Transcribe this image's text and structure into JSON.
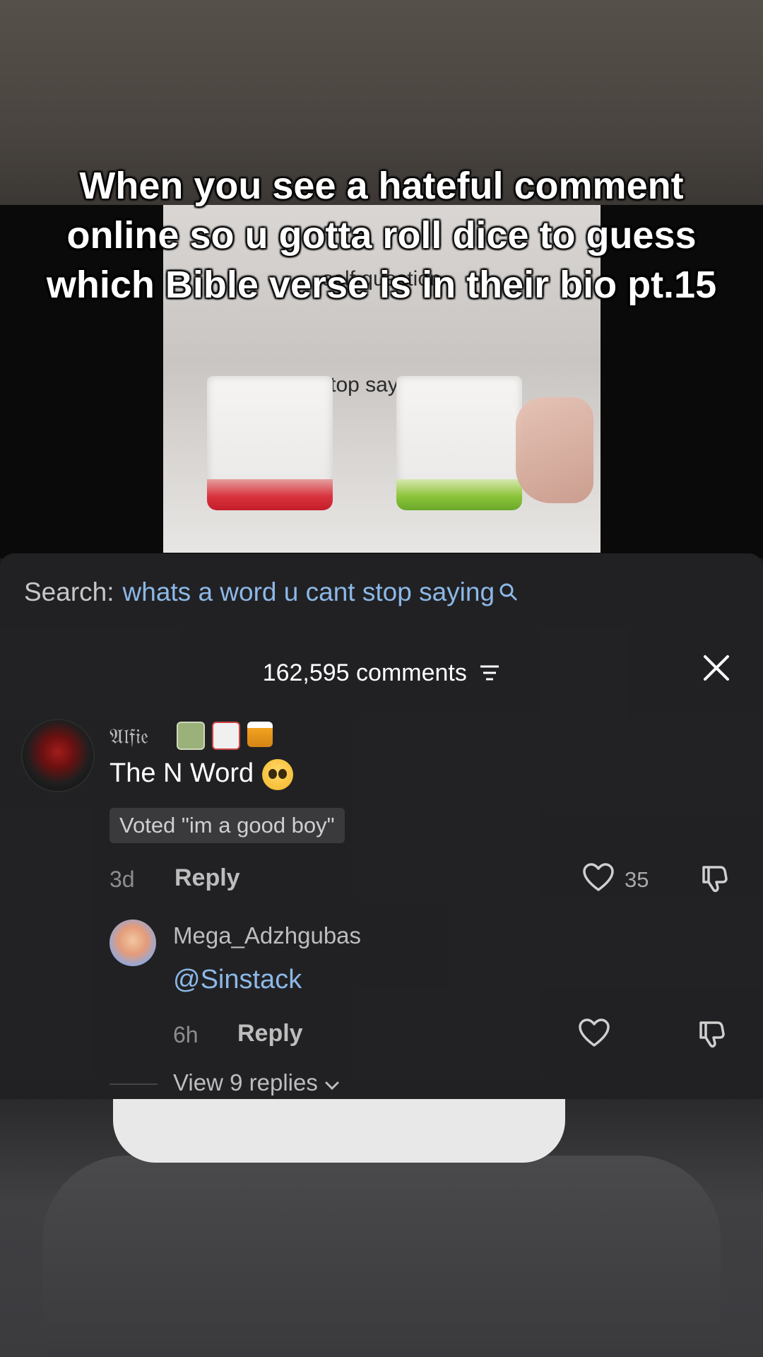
{
  "overlay_title": "When you see a hateful comment online so u gotta roll dice to guess which Bible verse is in their bio pt.15",
  "video": {
    "top_label": "self question",
    "caption": "stop saying ?"
  },
  "comments": {
    "search_label": "Search:",
    "search_query": "whats a word u cant stop saying",
    "count_label": "162,595 comments",
    "items": [
      {
        "user": "𝔄𝔩𝔣𝔦𝔢",
        "emoji_icons": [
          "money-icon",
          "card-icon",
          "beer-icon"
        ],
        "text": "The N Word",
        "text_emoji": "pleading-face-icon",
        "vote_chip": "Voted \"im a good boy\"",
        "age": "3d",
        "reply_label": "Reply",
        "likes": "35"
      }
    ],
    "replies": [
      {
        "user": "Mega_Adzhgubas",
        "text": "@Sinstack",
        "age": "6h",
        "reply_label": "Reply",
        "likes": ""
      }
    ],
    "view_replies": "View 9 replies"
  },
  "colors": {
    "panel_bg": "#222224",
    "link_blue": "#8cb8e6",
    "text_white": "#ffffff"
  }
}
